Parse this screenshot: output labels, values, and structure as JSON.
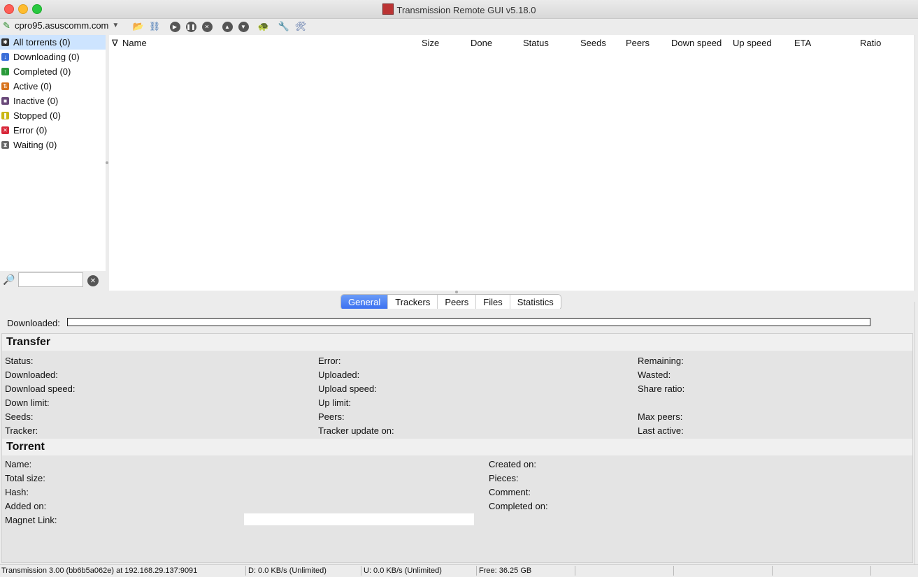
{
  "window": {
    "title": "Transmission Remote GUI v5.18.0"
  },
  "toolbar": {
    "connection": "cpro95.asuscomm.com"
  },
  "sidebar": {
    "items": [
      {
        "label": "All torrents (0)",
        "color": "#333333"
      },
      {
        "label": "Downloading (0)",
        "color": "#3b6fd8"
      },
      {
        "label": "Completed (0)",
        "color": "#2a9a3a"
      },
      {
        "label": "Active (0)",
        "color": "#d8731c"
      },
      {
        "label": "Inactive (0)",
        "color": "#6a4a7a"
      },
      {
        "label": "Stopped (0)",
        "color": "#c9b614"
      },
      {
        "label": "Error (0)",
        "color": "#d8283a"
      },
      {
        "label": "Waiting (0)",
        "color": "#666666"
      }
    ]
  },
  "search": {
    "value": ""
  },
  "torrent_list": {
    "columns": [
      "Name",
      "Size",
      "Done",
      "Status",
      "Seeds",
      "Peers",
      "Down speed",
      "Up speed",
      "ETA",
      "Ratio"
    ],
    "sort_indicator": "∇"
  },
  "tabs": [
    "General",
    "Trackers",
    "Peers",
    "Files",
    "Statistics"
  ],
  "general": {
    "downloaded_label": "Downloaded:",
    "transfer_title": "Transfer",
    "transfer_col1": [
      "Status:",
      "Downloaded:",
      "Download speed:",
      "Down limit:",
      "Seeds:",
      "Tracker:"
    ],
    "transfer_col2": [
      "Error:",
      "Uploaded:",
      "Upload speed:",
      "Up limit:",
      "Peers:",
      "Tracker update on:"
    ],
    "transfer_col3": [
      "Remaining:",
      "Wasted:",
      "Share ratio:",
      "",
      "Max peers:",
      "Last active:"
    ],
    "torrent_title": "Torrent",
    "torrent_col1": [
      "Name:",
      "Total size:",
      "Hash:",
      "Added on:",
      "Magnet Link:"
    ],
    "torrent_col2": [
      "Created on:",
      "Pieces:",
      "Comment:",
      "Completed on:"
    ]
  },
  "statusbar": {
    "server": "Transmission 3.00 (bb6b5a062e) at 192.168.29.137:9091",
    "down": "D: 0.0 KB/s (Unlimited)",
    "up": "U: 0.0 KB/s (Unlimited)",
    "free": "Free: 36.25 GB"
  }
}
